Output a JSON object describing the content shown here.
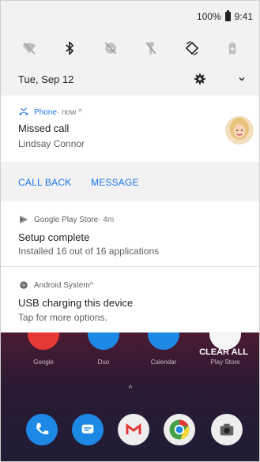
{
  "status_bar": {
    "battery": "100%",
    "time": "9:41"
  },
  "quick_settings": {
    "date": "Tue, Sep 12",
    "tiles": [
      "wifi-off-icon",
      "bluetooth-icon",
      "do-not-disturb-off-icon",
      "flashlight-off-icon",
      "auto-rotate-icon",
      "battery-saver-icon"
    ]
  },
  "notifications": [
    {
      "app": "Phone",
      "meta": " · now ^",
      "title": "Missed call",
      "text": "Lindsay Connor",
      "actions": [
        "CALL BACK",
        "MESSAGE"
      ]
    },
    {
      "app": "Google Play Store",
      "meta": " · 4m",
      "title": "Setup complete",
      "text": "Installed 16 out of 16 applications"
    },
    {
      "app": "Android System",
      "meta": " ^",
      "title": "USB charging this device",
      "text": "Tap for more options."
    }
  ],
  "home": {
    "apps": [
      "Google",
      "Duo",
      "Calendar",
      "Play Store"
    ],
    "clear_all": "CLEAR ALL",
    "caret": "^"
  },
  "colors": {
    "accent": "#1a73e8",
    "panel": "#f2f2f2"
  }
}
